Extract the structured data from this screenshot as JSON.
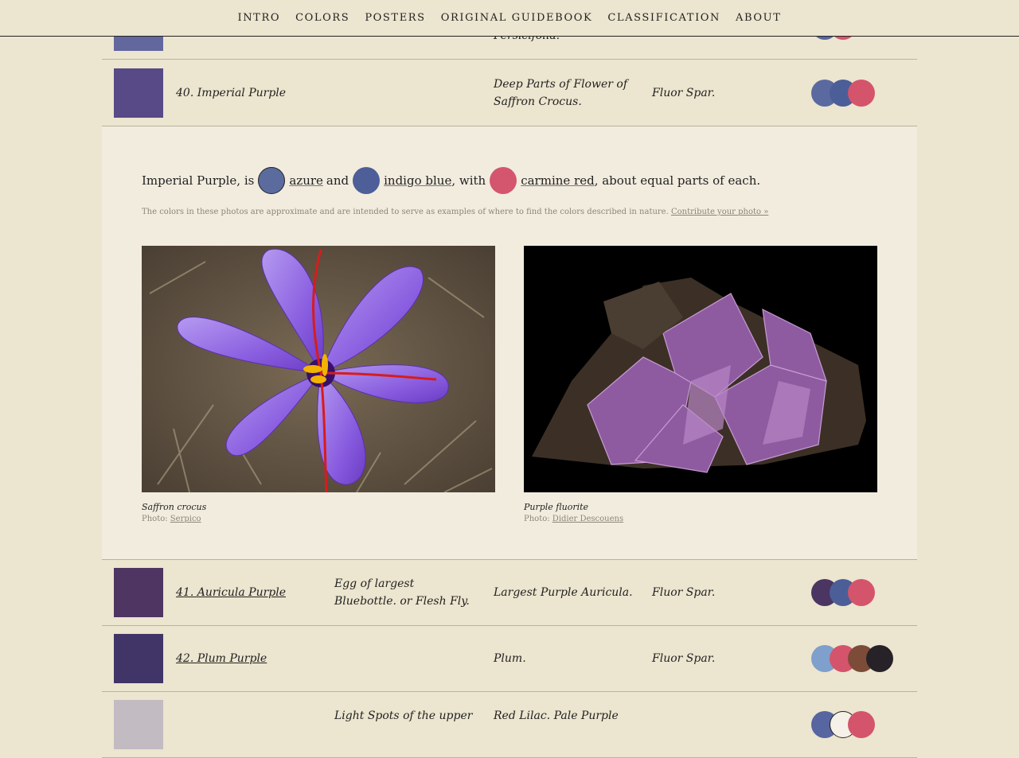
{
  "nav": {
    "items": [
      "INTRO",
      "COLORS",
      "POSTERS",
      "ORIGINAL GUIDEBOOK",
      "CLASSIFICATION",
      "ABOUT"
    ]
  },
  "rows": {
    "r39": {
      "vegetable": "Persicifolia.",
      "swatch": "#62679e",
      "dots": [
        "#5765a0",
        "#d4546c"
      ]
    },
    "r40": {
      "name": "40. Imperial Purple",
      "vegetable": "Deep Parts of Flower of Saffron Crocus.",
      "mineral": "Fluor Spar.",
      "swatch": "#574a87",
      "dots": [
        "#5a6aa0",
        "#4c5e98",
        "#d4546c"
      ]
    },
    "r41": {
      "name": "41. Auricula Purple",
      "animal": "Egg of largest Bluebottle. or Flesh Fly.",
      "vegetable": "Largest Purple Auricula.",
      "mineral": "Fluor Spar.",
      "swatch": "#4f3561",
      "dots": [
        "#4a3563",
        "#4c5e98",
        "#d4546c"
      ]
    },
    "r42": {
      "name": "42. Plum Purple",
      "vegetable": "Plum.",
      "mineral": "Fluor Spar.",
      "swatch": "#403566",
      "dots": [
        "#7f9fcc",
        "#d4546c",
        "#7c4c38",
        "#262228"
      ]
    },
    "r43": {
      "animal": "Light Spots of the upper",
      "vegetable": "Red Lilac. Pale Purple",
      "swatch": "#c2bbc2",
      "dots": [
        "#5765a0",
        "#f5f0e8",
        "#d4546c"
      ]
    }
  },
  "detail": {
    "intro": "Imperial Purple, is",
    "c1": {
      "label": "azure",
      "color": "#5b6b9e"
    },
    "and": "and",
    "c2": {
      "label": "indigo blue",
      "color": "#4d5e98"
    },
    "with": ", with",
    "c3": {
      "label": "carmine red",
      "color": "#d3566e"
    },
    "outro": ", about equal parts of each.",
    "note": "The colors in these photos are approximate and are intended to serve as examples of where to find the colors described in nature.",
    "contribute": "Contribute your photo »",
    "photos": [
      {
        "title": "Saffron crocus",
        "credit_prefix": "Photo:",
        "credit": "Serpico"
      },
      {
        "title": "Purple fluorite",
        "credit_prefix": "Photo:",
        "credit": "Didier Descouens"
      }
    ]
  }
}
